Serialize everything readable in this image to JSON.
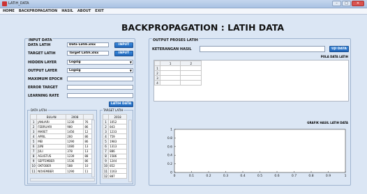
{
  "window": {
    "title": "LATIH_DATA",
    "minimize": "–",
    "maximize": "□",
    "close": "✕"
  },
  "menu": [
    "HOME",
    "BACKPROPAGATION",
    "HASIL",
    "ABOUT",
    "EXIT"
  ],
  "app_title": "BACKPROPAGATION : LATIH DATA",
  "input_panel": {
    "title": "INPUT DATA",
    "data_latih_label": "DATA LATIH",
    "data_latih_value": "Data Latih.xlsx",
    "target_latih_label": "TARGET LATIH",
    "target_latih_value": "Target Latih.xlsx",
    "input_button": "INPUT",
    "hidden_layer_label": "HIDDEN LAYER",
    "hidden_layer_value": "Logsig",
    "output_layer_label": "OUTPUT LAYER",
    "output_layer_value": "Logsig",
    "max_epoch_label": "MAXIMUM EPOCH",
    "error_target_label": "ERROR TARGET",
    "learning_rate_label": "LEARNING RATE",
    "latih_button": "LATIH DATA"
  },
  "data_latih_table": {
    "title": "DATA LATIH",
    "headers": [
      "BULAN",
      "2008"
    ],
    "rows": [
      [
        "1",
        "JANUARI",
        "1230",
        "76"
      ],
      [
        "2",
        "FEBRUARI",
        "980",
        "86"
      ],
      [
        "3",
        "MARET",
        "1456",
        "12"
      ],
      [
        "4",
        "APRIL",
        "260",
        "86"
      ],
      [
        "5",
        "MEI",
        "1290",
        "86"
      ],
      [
        "6",
        "JUNI",
        "1080",
        "13"
      ],
      [
        "7",
        "JULI",
        "378",
        "13"
      ],
      [
        "8",
        "AGUSTUS",
        "1239",
        "88"
      ],
      [
        "9",
        "SEPTEMBER",
        "1536",
        "86"
      ],
      [
        "10",
        "OKTOBER",
        "588",
        "10"
      ],
      [
        "11",
        "NOVEMBER",
        "1290",
        "11"
      ]
    ]
  },
  "target_latih_table": {
    "title": "TARGET LATIH",
    "headers": [
      "2018"
    ],
    "rows": [
      [
        "1",
        "1052"
      ],
      [
        "2",
        "843"
      ],
      [
        "3",
        "1233"
      ],
      [
        "4",
        "759"
      ],
      [
        "5",
        "1983"
      ],
      [
        "6",
        "1313"
      ],
      [
        "7",
        "886"
      ],
      [
        "8",
        "1586"
      ],
      [
        "9",
        "1244"
      ],
      [
        "10",
        "852"
      ],
      [
        "11",
        "1163"
      ],
      [
        "12",
        "887"
      ]
    ]
  },
  "output_panel": {
    "title": "OUTPUT PROSES LATIH",
    "keterangan_label": "KETERANGAN HASIL",
    "uji_button": "UJI DATA",
    "pola_title": "POLA DATA LATIH",
    "pola_headers": [
      "1",
      "2"
    ],
    "pola_rows": [
      "1",
      "2",
      "3",
      "4"
    ],
    "grafik_title": "GRAFIK HASIL LATIH DATA"
  },
  "chart_data": {
    "type": "line",
    "title": "",
    "xlabel": "",
    "ylabel": "",
    "xlim": [
      0,
      1
    ],
    "ylim": [
      0,
      1
    ],
    "x_ticks": [
      "0",
      "0.1",
      "0.2",
      "0.3",
      "0.4",
      "0.5",
      "0.6",
      "0.7",
      "0.8",
      "0.9",
      "1"
    ],
    "y_ticks": [
      "0",
      "0.2",
      "0.4",
      "0.6",
      "0.8",
      "1"
    ],
    "series": [],
    "grid": false
  }
}
